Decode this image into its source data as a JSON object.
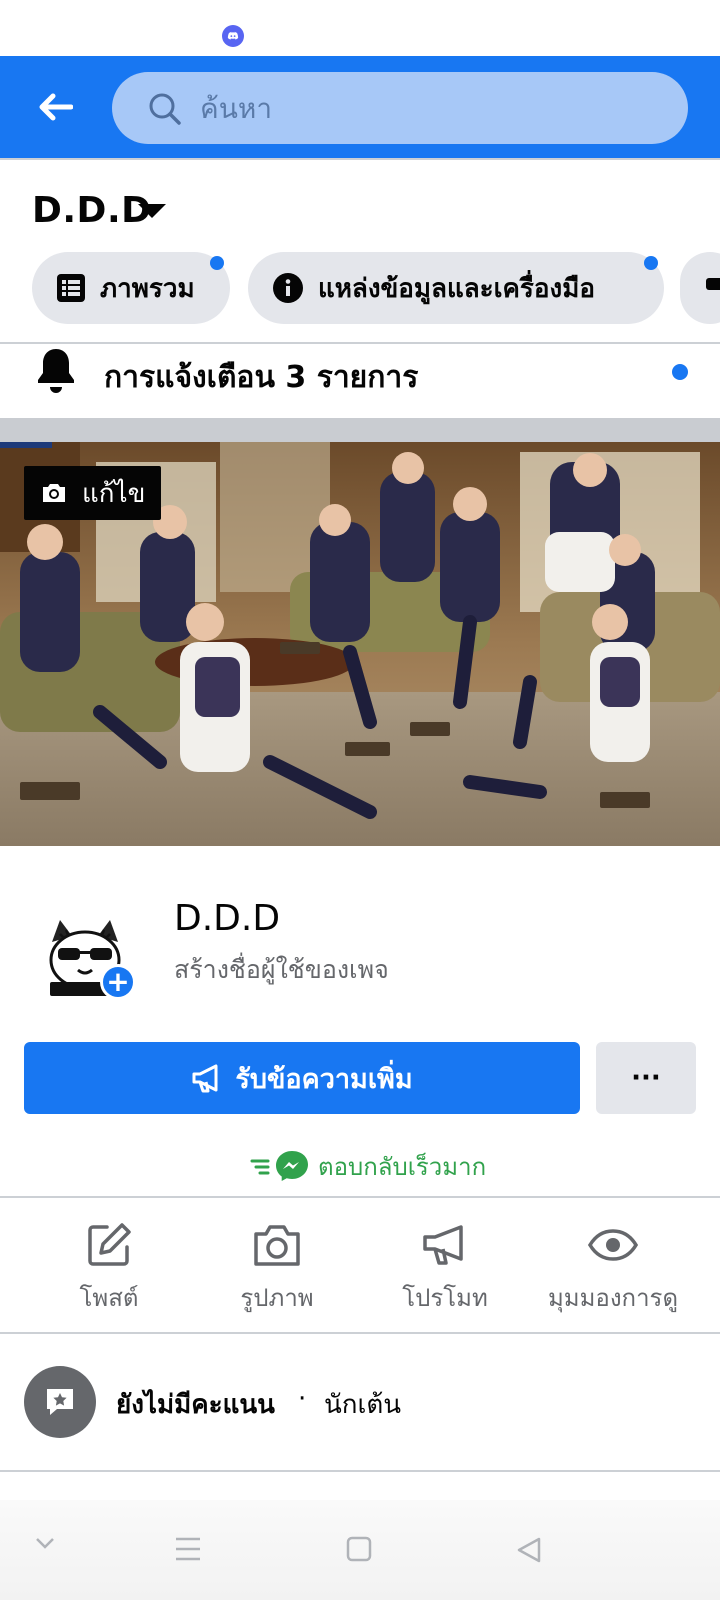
{
  "header": {
    "search_placeholder": "ค้นหา"
  },
  "page": {
    "title": "D.D.D"
  },
  "chips": [
    {
      "label": "ภาพรวม",
      "icon": "list-icon",
      "has_dot": true
    },
    {
      "label": "แหล่งข้อมูลและเครื่องมือ",
      "icon": "info-icon",
      "has_dot": true
    }
  ],
  "notifications": {
    "label": "การแจ้งเตือน 3 รายการ"
  },
  "cover": {
    "edit_label": "แก้ไข"
  },
  "profile": {
    "name": "D.D.D",
    "create_username": "สร้างชื่อผู้ใช้ของเพจ"
  },
  "buttons": {
    "primary_label": "รับข้อความเพิ่ม",
    "more_label": "···"
  },
  "responsiveness": {
    "label": "ตอบกลับเร็วมาก"
  },
  "actions": [
    {
      "label": "โพสต์",
      "icon": "compose-icon"
    },
    {
      "label": "รูปภาพ",
      "icon": "camera-icon"
    },
    {
      "label": "โปรโมท",
      "icon": "megaphone-icon"
    },
    {
      "label": "มุมมองการดู",
      "icon": "eye-icon"
    }
  ],
  "rating": {
    "status": "ยังไม่มีคะแนน",
    "separator": "·",
    "category": "นักเต้น"
  },
  "colors": {
    "brand_blue": "#1877F2",
    "green": "#31a24c",
    "chip_gray": "#e4e6eb"
  }
}
